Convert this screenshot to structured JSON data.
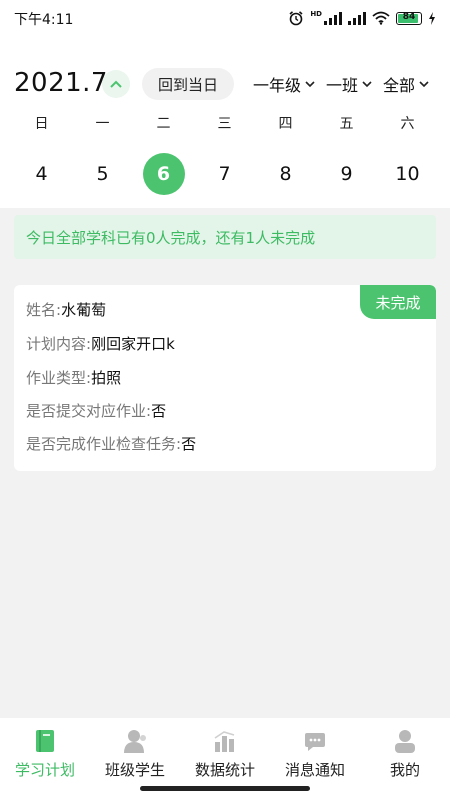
{
  "status_bar": {
    "time": "下午4:11",
    "battery": "84",
    "battery_level": 0.84,
    "network": "HD"
  },
  "header": {
    "month": "2021.7",
    "today_button": "回到当日",
    "grade_filter": "一年级",
    "class_filter": "一班",
    "subject_filter": "全部"
  },
  "week": {
    "labels": [
      "日",
      "一",
      "二",
      "三",
      "四",
      "五",
      "六"
    ],
    "days": [
      "4",
      "5",
      "6",
      "7",
      "8",
      "9",
      "10"
    ],
    "selected_day": "6"
  },
  "summary": "今日全部学科已有0人完成，还有1人未完成",
  "card": {
    "badge": "未完成",
    "rows": [
      {
        "label": "姓名: ",
        "value": "水葡萄"
      },
      {
        "label": "计划内容: ",
        "value": "刚回家开口k"
      },
      {
        "label": "作业类型: ",
        "value": "拍照"
      },
      {
        "label": "是否提交对应作业: ",
        "value": "否"
      },
      {
        "label": "是否完成作业检查任务: ",
        "value": "否"
      }
    ]
  },
  "nav": [
    {
      "label": "学习计划",
      "icon": "book-icon",
      "active": true
    },
    {
      "label": "班级学生",
      "icon": "person-icon",
      "active": false
    },
    {
      "label": "数据统计",
      "icon": "bar-chart-icon",
      "active": false
    },
    {
      "label": "消息通知",
      "icon": "chat-bubble-icon",
      "active": false
    },
    {
      "label": "我的",
      "icon": "profile-icon",
      "active": false
    }
  ],
  "colors": {
    "accent": "#4cc46f",
    "summary_bg": "#e3f4e8",
    "summary_text": "#3dbb63"
  }
}
